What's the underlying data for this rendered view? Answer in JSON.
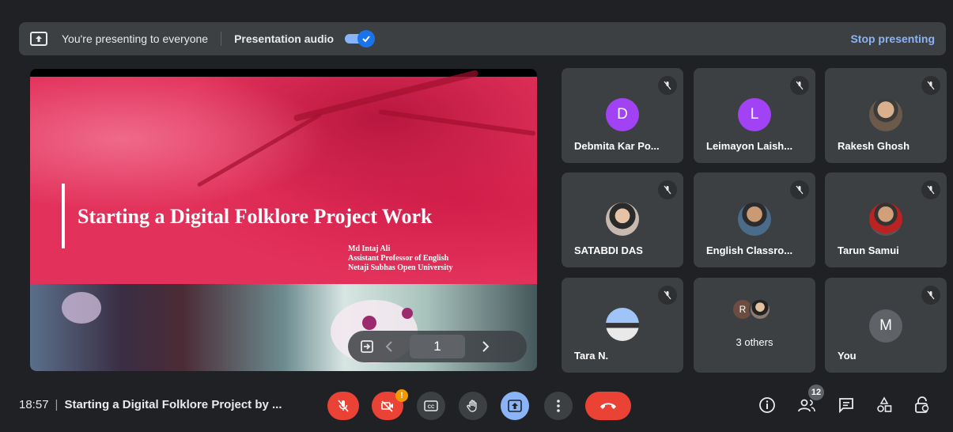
{
  "banner": {
    "presenting_text": "You're presenting to everyone",
    "audio_label": "Presentation audio",
    "audio_enabled": true,
    "stop_label": "Stop presenting"
  },
  "slide": {
    "title": "Starting a Digital Folklore Project Work",
    "author_lines": [
      "Md Intaj Ali",
      "Assistant Professor of English",
      "Netaji Subhas Open University"
    ],
    "page_number": "1"
  },
  "participants": [
    {
      "name": "Debmita Kar Po...",
      "initial": "D",
      "avatar_color": "#a142f4",
      "muted": true
    },
    {
      "name": "Leimayon Laish...",
      "initial": "L",
      "avatar_color": "#a142f4",
      "muted": true
    },
    {
      "name": "Rakesh Ghosh",
      "initial": "",
      "avatar_color": "#6b5a4a",
      "muted": true
    },
    {
      "name": "SATABDI DAS",
      "initial": "",
      "avatar_color": "#8d7b70",
      "muted": true
    },
    {
      "name": "English Classro...",
      "initial": "",
      "avatar_color": "#7a6a55",
      "muted": true
    },
    {
      "name": "Tarun Samui",
      "initial": "",
      "avatar_color": "#6e5a4e",
      "muted": true
    },
    {
      "name": "Tara N.",
      "initial": "",
      "avatar_color": "#6fa8dc",
      "muted": true
    },
    {
      "name": "You",
      "initial": "M",
      "avatar_color": "#5f6368",
      "muted": true
    }
  ],
  "others_tile": {
    "label": "3 others",
    "initial": "R",
    "avatar_color": "#6d4c41"
  },
  "bottom": {
    "time": "18:57",
    "meeting_title": "Starting a Digital Folklore Project by ...",
    "camera_alert": "!",
    "people_count": "12"
  },
  "colors": {
    "accent": "#8ab4f8",
    "end_call": "#ea4335",
    "mic_off": "#ea4335",
    "present_active": "#8ab4f8"
  }
}
